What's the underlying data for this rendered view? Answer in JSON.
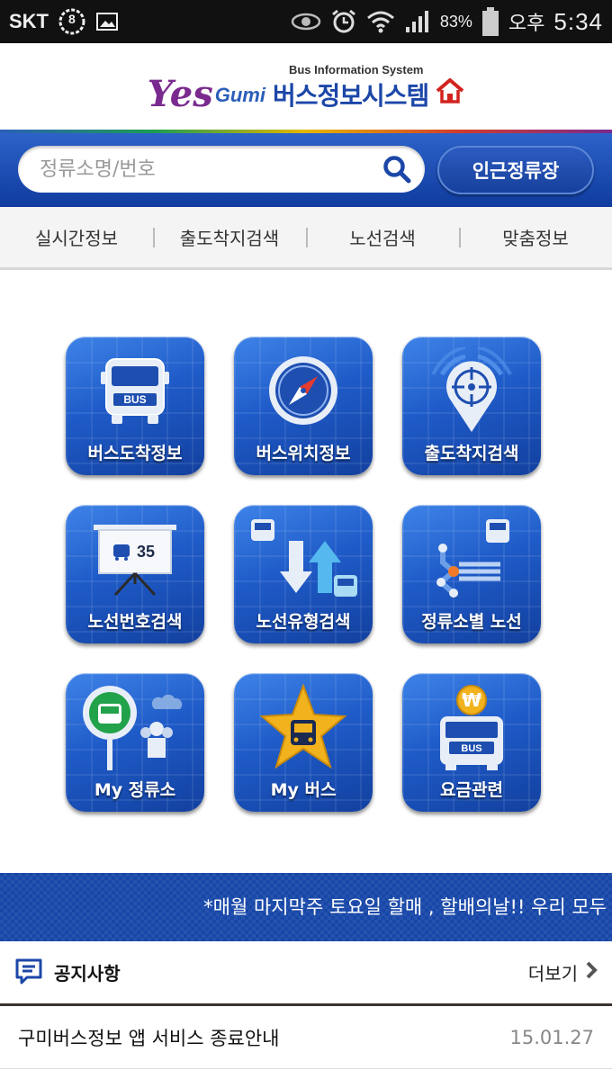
{
  "status_bar": {
    "carrier": "SKT",
    "notification_count": "8",
    "battery": "83%",
    "ampm": "오후",
    "time": "5:34"
  },
  "header": {
    "logo_yes": "Yes",
    "logo_gumi": "Gumi",
    "subtitle": "Bus Information System",
    "title": "버스정보시스템"
  },
  "search": {
    "placeholder": "정류소명/번호",
    "nearby_label": "인근정류장"
  },
  "tabs": [
    {
      "label": "실시간정보"
    },
    {
      "label": "출도착지검색"
    },
    {
      "label": "노선검색"
    },
    {
      "label": "맞춤정보"
    }
  ],
  "menu": [
    {
      "label": "버스도착정보",
      "icon": "bus-front-icon"
    },
    {
      "label": "버스위치정보",
      "icon": "compass-icon"
    },
    {
      "label": "출도착지검색",
      "icon": "location-pin-icon"
    },
    {
      "label": "노선번호검색",
      "icon": "route-board-icon",
      "board_text": "35"
    },
    {
      "label": "노선유형검색",
      "icon": "route-type-icon"
    },
    {
      "label": "정류소별 노선",
      "icon": "stop-route-map-icon"
    },
    {
      "label": "My 정류소",
      "icon": "bus-stop-sign-icon"
    },
    {
      "label": "My 버스",
      "icon": "star-bus-icon"
    },
    {
      "label": "요금관련",
      "icon": "fare-won-icon"
    }
  ],
  "bus_label": "BUS",
  "ticker": {
    "text": "*매월 마지막주 토요일 할매 , 할배의날!! 우리 모두"
  },
  "notice": {
    "title": "공지사항",
    "more_label": "더보기",
    "items": [
      {
        "title": "구미버스정보 앱 서비스 종료안내",
        "date": "15.01.27"
      }
    ]
  },
  "colors": {
    "brand_blue": "#1c47a8",
    "tile_blue": "#1f5bc8",
    "home_red": "#d2231f"
  }
}
